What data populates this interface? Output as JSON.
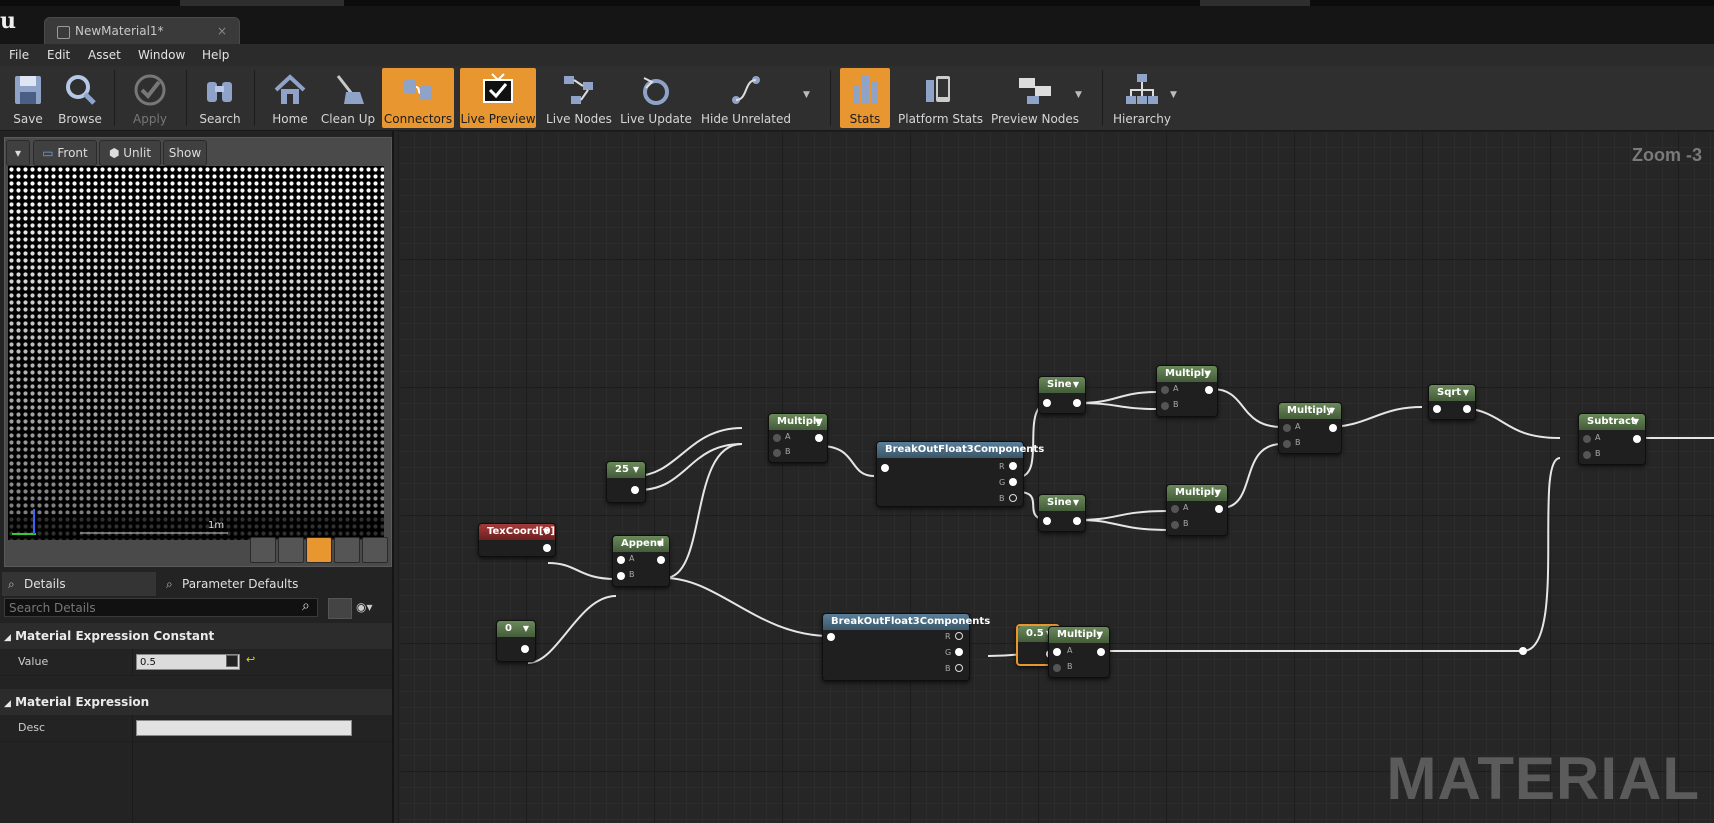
{
  "window": {
    "tab_title": "NewMaterial1*",
    "tab_close": "×"
  },
  "menu": [
    "File",
    "Edit",
    "Asset",
    "Window",
    "Help"
  ],
  "toolbar": [
    {
      "label": "Save",
      "icon": "save-icon"
    },
    {
      "label": "Browse",
      "icon": "browse-icon"
    },
    {
      "label": "Apply",
      "icon": "apply-icon",
      "disabled": true
    },
    {
      "label": "Search",
      "icon": "search-icon"
    },
    {
      "label": "Home",
      "icon": "home-icon"
    },
    {
      "label": "Clean Up",
      "icon": "clean-up-icon"
    },
    {
      "label": "Connectors",
      "icon": "connectors-icon",
      "active": true
    },
    {
      "label": "Live Preview",
      "icon": "live-preview-icon",
      "active": true
    },
    {
      "label": "Live Nodes",
      "icon": "live-nodes-icon"
    },
    {
      "label": "Live Update",
      "icon": "live-update-icon"
    },
    {
      "label": "Hide Unrelated",
      "icon": "hide-unrelated-icon"
    },
    {
      "label": "Stats",
      "icon": "stats-icon",
      "active": true
    },
    {
      "label": "Platform Stats",
      "icon": "platform-stats-icon"
    },
    {
      "label": "Preview Nodes",
      "icon": "preview-nodes-icon"
    },
    {
      "label": "Hierarchy",
      "icon": "hierarchy-icon"
    }
  ],
  "viewport": {
    "view_mode": "Front",
    "lighting_mode": "Unlit",
    "show_label": "Show",
    "scale_label": "1m"
  },
  "details": {
    "tab_details": "Details",
    "tab_params": "Parameter Defaults",
    "search_placeholder": "Search Details",
    "category1": "Material Expression Constant",
    "value_label": "Value",
    "value": "0.5",
    "category2": "Material Expression",
    "desc_label": "Desc",
    "desc_value": ""
  },
  "graph": {
    "zoom": "Zoom -3",
    "watermark": "MATERIAL",
    "nodes": {
      "const25": "25",
      "const0": "0",
      "texcoord": "TexCoord[0]",
      "append": "Append",
      "multiply1": "Multiply",
      "breakout1": "BreakOutFloat3Components",
      "breakout2": "BreakOutFloat3Components",
      "sine1": "Sine",
      "sine2": "Sine",
      "multiply2": "Multiply",
      "multiply3": "Multiply",
      "multiply4": "Multiply",
      "multiply5": "Multiply",
      "const05": "0.5",
      "sqrt": "Sqrt",
      "subtract": "Subtract"
    },
    "pins": {
      "a": "A",
      "b": "B",
      "r": "R",
      "g": "G",
      "bb": "B"
    }
  }
}
